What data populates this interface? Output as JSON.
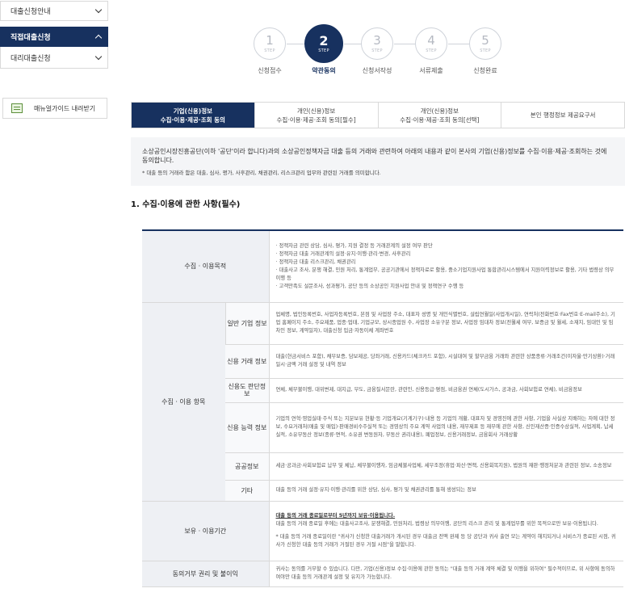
{
  "sidebar": {
    "items": [
      {
        "label": "대출신청안내",
        "active": false
      },
      {
        "label": "직접대출신청",
        "active": true
      },
      {
        "label": "대리대출신청",
        "active": false
      }
    ],
    "manual_label": "매뉴얼가이드 내려받기"
  },
  "steps": [
    {
      "num": "1",
      "tag": "STEP",
      "label": "신청접수"
    },
    {
      "num": "2",
      "tag": "STEP",
      "label": "약관동의"
    },
    {
      "num": "3",
      "tag": "STEP",
      "label": "신청서작성"
    },
    {
      "num": "4",
      "tag": "STEP",
      "label": "서류제출"
    },
    {
      "num": "5",
      "tag": "STEP",
      "label": "신청완료"
    }
  ],
  "active_step": 2,
  "tabs": [
    {
      "line1": "기업(신용)정보",
      "line2": "수집·이용·제공·조회 동의"
    },
    {
      "line1": "개인(신용)정보",
      "line2": "수집·이용·제공·조회 동의[필수]"
    },
    {
      "line1": "개인(신용)정보",
      "line2": "수집·이용·제공·조회 동의[선택]"
    },
    {
      "line1": "본인 행정정보 제공요구서",
      "line2": ""
    }
  ],
  "intro": {
    "text": "소상공인시장진흥공단(이하 '공단'이라 합니다)과의 소상공인정책자금 대출 등의 거래와 관련하여 아래의 내용과 같이 본사의 기업(신용)정보를 수집·이용·제공·조회하는 것에 동의합니다.",
    "note": "* 대출 등의 거래라 함은 대출, 심사, 평가, 사후관리, 채권관리, 리스크관리 업무와 관련된 거래를 의미합니다."
  },
  "section_title": "1. 수집·이용에 관한 사항(필수)",
  "table": {
    "purpose_header": "수집 · 이용목적",
    "purpose_items": [
      "정책자금 관련 상담, 심사, 평가, 지원 결정 등 거래관계의 설정 여부 판단",
      "정책자금 대출 거래관계의 설정·유지·이행·관리·변경, 사후관리",
      "정책자금 대출 리스크관리, 채권관리",
      "대출사고 조사, 분쟁 해결, 민원 처리, 통계업무, 공공기관에서 정책자료로 활용, 중소기업지원사업 통합관리시스템에서 지원이력정보로 활용, 기타 법령상 의무이행 등",
      "고객만족도 설문조사, 성과평가, 공단 등의 소상공인 지원사업 안내 및 정책연구 수행 등"
    ],
    "items_header": "수집 · 이용 항목",
    "rows": [
      {
        "label": "일반 기업 정보",
        "text": "업체명, 법인등록번호, 사업자등록번호, 본점 및 사업장 주소, 대표자 성명 및 개인식별번호, 설립연월일(사업개시일), 연락처(전화번호·Fax번호·E-mail주소), 기업 홈페이지 주소, 주요제품, 업종·업태, 기업규모, 상시종업원 수, 사업장 소유구분 정보, 사업장 임대차 정보(전월세 여부, 보증금 및 월세, 소재지, 임대인 및 임차인 정보, 계약일자), 대출신청 입금·자동이체 계좌번호"
      },
      {
        "label": "신용 거래 정보",
        "text": "대출(현금서비스 포함), 채무보증, 담보제공, 당좌거래, 신용카드(체크카드 포함), 시설대여 및 할부금융 거래와 관련한 상품종류·거래조건(이자율·만기상환)·거래일시·금액 거래 설정 및 내역 정보"
      },
      {
        "label": "신용도 판단정보",
        "text": "연체, 체무불이행, 대위변제, 대지급, 부도, 금융질서문란, 관련인, 신용등급·평점, 비금융권 연체(도시가스, 공과금, 사회보험료 연체), 비금융정보"
      },
      {
        "label": "신용 능력 정보",
        "text": "기업의 연혁·영업실태·주식 또는 지분보유 현황·등 기업개요(기계기구)·내용 등 기업의 개황, 대표자 및 경영진에 관한 사항, 기업을 사실상 지배하는 자에 대한 정보, 수요거래처(매출 및 매입)·판매경비수주실적 또는 경영상의 주요 계약 사업의 내용, 재무제표 등 재무에 관한 사항, 신인재산증·인증수상실적, 사업계획, 납세실적, 소유부동산 정보(종류·면적, 소유권 변동원자, 부동산 권리내용), 폐업정보, 신용거래정보, 금융회사 거래상황"
      },
      {
        "label": "공공정보",
        "text": "세금·공과금·사회보험료 납부 및 체납, 체무불이행자, 임금체불사업체, 세무조정(휴업·파산·면책, 신용회복지원), 법원의 재판·행정처분과 관련된 정보, 소송정보"
      },
      {
        "label": "기타",
        "text": "대출 등의 거래 설정·유지·이행·관리를 위한 상담, 심사, 평가 및 채권관리를 통해 생성되는 정보"
      }
    ],
    "retention_header": "보유 · 이용기간",
    "retention_bold": "대출 등의 거래 종료일로부터 5년까지 보유·이용됩니다.",
    "retention_text": "대출 등의 거래 종료일 후에는 대출사고조사, 분쟁해결, 민원처리, 법령상 의무이행, 공단의 리스크 관리 및 통계업무를 위한 목적으로만 보유·이용됩니다.",
    "retention_note": "* 대출 등의 거래 종료일이란 \"귀사가 신청한 대출거래가 개시된 경우 대출금 전액 완제 등 당 공단과 귀사 출연 모는 계약이 해지되거나 서비스가 종료된 시점, 귀사가 신청한 대출 등의 거래가 거절된 경우 거절 시점\"을 말합니다.",
    "refusal_header": "동의거부 권리 및 불이익",
    "refusal_text": "귀사는 동의를 거부할 수 있습니다. 다만, 기업(신용)정보 수집·이용에 관한 동의는 \"대출 등의 거래 계약 체결 및 이행을 위하여\" 필수적이므로, 위 사항에 동의하여야만 대출 등의 거래관계 설정 및 유지가 가능합니다."
  }
}
